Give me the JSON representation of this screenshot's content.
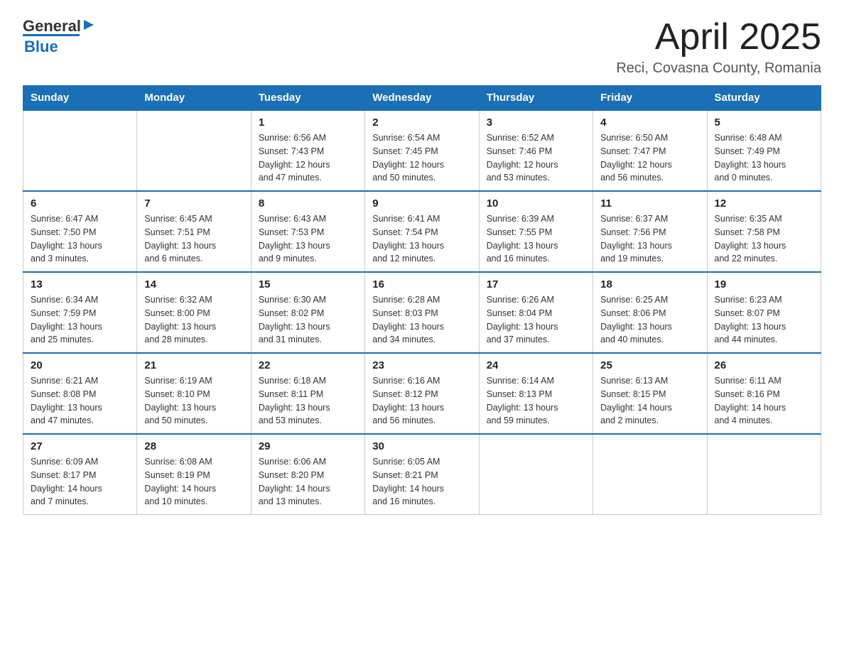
{
  "header": {
    "title": "April 2025",
    "location": "Reci, Covasna County, Romania",
    "logo_general": "General",
    "logo_blue": "Blue"
  },
  "days_of_week": [
    "Sunday",
    "Monday",
    "Tuesday",
    "Wednesday",
    "Thursday",
    "Friday",
    "Saturday"
  ],
  "weeks": [
    [
      {
        "day": "",
        "info": ""
      },
      {
        "day": "",
        "info": ""
      },
      {
        "day": "1",
        "info": "Sunrise: 6:56 AM\nSunset: 7:43 PM\nDaylight: 12 hours\nand 47 minutes."
      },
      {
        "day": "2",
        "info": "Sunrise: 6:54 AM\nSunset: 7:45 PM\nDaylight: 12 hours\nand 50 minutes."
      },
      {
        "day": "3",
        "info": "Sunrise: 6:52 AM\nSunset: 7:46 PM\nDaylight: 12 hours\nand 53 minutes."
      },
      {
        "day": "4",
        "info": "Sunrise: 6:50 AM\nSunset: 7:47 PM\nDaylight: 12 hours\nand 56 minutes."
      },
      {
        "day": "5",
        "info": "Sunrise: 6:48 AM\nSunset: 7:49 PM\nDaylight: 13 hours\nand 0 minutes."
      }
    ],
    [
      {
        "day": "6",
        "info": "Sunrise: 6:47 AM\nSunset: 7:50 PM\nDaylight: 13 hours\nand 3 minutes."
      },
      {
        "day": "7",
        "info": "Sunrise: 6:45 AM\nSunset: 7:51 PM\nDaylight: 13 hours\nand 6 minutes."
      },
      {
        "day": "8",
        "info": "Sunrise: 6:43 AM\nSunset: 7:53 PM\nDaylight: 13 hours\nand 9 minutes."
      },
      {
        "day": "9",
        "info": "Sunrise: 6:41 AM\nSunset: 7:54 PM\nDaylight: 13 hours\nand 12 minutes."
      },
      {
        "day": "10",
        "info": "Sunrise: 6:39 AM\nSunset: 7:55 PM\nDaylight: 13 hours\nand 16 minutes."
      },
      {
        "day": "11",
        "info": "Sunrise: 6:37 AM\nSunset: 7:56 PM\nDaylight: 13 hours\nand 19 minutes."
      },
      {
        "day": "12",
        "info": "Sunrise: 6:35 AM\nSunset: 7:58 PM\nDaylight: 13 hours\nand 22 minutes."
      }
    ],
    [
      {
        "day": "13",
        "info": "Sunrise: 6:34 AM\nSunset: 7:59 PM\nDaylight: 13 hours\nand 25 minutes."
      },
      {
        "day": "14",
        "info": "Sunrise: 6:32 AM\nSunset: 8:00 PM\nDaylight: 13 hours\nand 28 minutes."
      },
      {
        "day": "15",
        "info": "Sunrise: 6:30 AM\nSunset: 8:02 PM\nDaylight: 13 hours\nand 31 minutes."
      },
      {
        "day": "16",
        "info": "Sunrise: 6:28 AM\nSunset: 8:03 PM\nDaylight: 13 hours\nand 34 minutes."
      },
      {
        "day": "17",
        "info": "Sunrise: 6:26 AM\nSunset: 8:04 PM\nDaylight: 13 hours\nand 37 minutes."
      },
      {
        "day": "18",
        "info": "Sunrise: 6:25 AM\nSunset: 8:06 PM\nDaylight: 13 hours\nand 40 minutes."
      },
      {
        "day": "19",
        "info": "Sunrise: 6:23 AM\nSunset: 8:07 PM\nDaylight: 13 hours\nand 44 minutes."
      }
    ],
    [
      {
        "day": "20",
        "info": "Sunrise: 6:21 AM\nSunset: 8:08 PM\nDaylight: 13 hours\nand 47 minutes."
      },
      {
        "day": "21",
        "info": "Sunrise: 6:19 AM\nSunset: 8:10 PM\nDaylight: 13 hours\nand 50 minutes."
      },
      {
        "day": "22",
        "info": "Sunrise: 6:18 AM\nSunset: 8:11 PM\nDaylight: 13 hours\nand 53 minutes."
      },
      {
        "day": "23",
        "info": "Sunrise: 6:16 AM\nSunset: 8:12 PM\nDaylight: 13 hours\nand 56 minutes."
      },
      {
        "day": "24",
        "info": "Sunrise: 6:14 AM\nSunset: 8:13 PM\nDaylight: 13 hours\nand 59 minutes."
      },
      {
        "day": "25",
        "info": "Sunrise: 6:13 AM\nSunset: 8:15 PM\nDaylight: 14 hours\nand 2 minutes."
      },
      {
        "day": "26",
        "info": "Sunrise: 6:11 AM\nSunset: 8:16 PM\nDaylight: 14 hours\nand 4 minutes."
      }
    ],
    [
      {
        "day": "27",
        "info": "Sunrise: 6:09 AM\nSunset: 8:17 PM\nDaylight: 14 hours\nand 7 minutes."
      },
      {
        "day": "28",
        "info": "Sunrise: 6:08 AM\nSunset: 8:19 PM\nDaylight: 14 hours\nand 10 minutes."
      },
      {
        "day": "29",
        "info": "Sunrise: 6:06 AM\nSunset: 8:20 PM\nDaylight: 14 hours\nand 13 minutes."
      },
      {
        "day": "30",
        "info": "Sunrise: 6:05 AM\nSunset: 8:21 PM\nDaylight: 14 hours\nand 16 minutes."
      },
      {
        "day": "",
        "info": ""
      },
      {
        "day": "",
        "info": ""
      },
      {
        "day": "",
        "info": ""
      }
    ]
  ]
}
